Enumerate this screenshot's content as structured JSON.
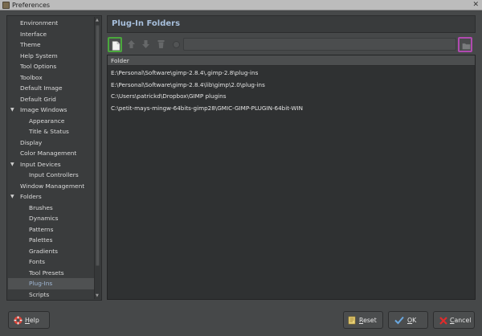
{
  "window": {
    "title": "Preferences",
    "close_glyph": "✕"
  },
  "sidebar": {
    "items": [
      {
        "label": "Environment",
        "level": 0
      },
      {
        "label": "Interface",
        "level": 0
      },
      {
        "label": "Theme",
        "level": 0
      },
      {
        "label": "Help System",
        "level": 0
      },
      {
        "label": "Tool Options",
        "level": 0
      },
      {
        "label": "Toolbox",
        "level": 0
      },
      {
        "label": "Default Image",
        "level": 0
      },
      {
        "label": "Default Grid",
        "level": 0
      },
      {
        "label": "Image Windows",
        "level": 0,
        "expanded": true
      },
      {
        "label": "Appearance",
        "level": 1
      },
      {
        "label": "Title & Status",
        "level": 1
      },
      {
        "label": "Display",
        "level": 0
      },
      {
        "label": "Color Management",
        "level": 0
      },
      {
        "label": "Input Devices",
        "level": 0,
        "expanded": true
      },
      {
        "label": "Input Controllers",
        "level": 1
      },
      {
        "label": "Window Management",
        "level": 0
      },
      {
        "label": "Folders",
        "level": 0,
        "expanded": true
      },
      {
        "label": "Brushes",
        "level": 1
      },
      {
        "label": "Dynamics",
        "level": 1
      },
      {
        "label": "Patterns",
        "level": 1
      },
      {
        "label": "Palettes",
        "level": 1
      },
      {
        "label": "Gradients",
        "level": 1
      },
      {
        "label": "Fonts",
        "level": 1
      },
      {
        "label": "Tool Presets",
        "level": 1
      },
      {
        "label": "Plug-Ins",
        "level": 1,
        "selected": true
      },
      {
        "label": "Scripts",
        "level": 1
      }
    ]
  },
  "main": {
    "title": "Plug-In Folders",
    "toolbar": {
      "icons": [
        "new-folder-icon",
        "move-up-icon",
        "move-down-icon",
        "delete-icon",
        "status-icon",
        "browse-folder-icon"
      ],
      "path_value": "",
      "highlight_new": "#4aa83c",
      "highlight_browse": "#b04ab0"
    },
    "table": {
      "column_header": "Folder",
      "rows": [
        "E:\\Personal\\Software\\gimp-2.8.4\\.gimp-2.8\\plug-ins",
        "E:\\Personal\\Software\\gimp-2.8.4\\lib\\gimp\\2.0\\plug-ins",
        "C:\\Users\\patrickd\\Dropbox\\GIMP plugins",
        "C:\\petit-mays-mingw-64bits-gimp28\\GMIC-GIMP-PLUGIN-64bit-WIN"
      ]
    }
  },
  "buttons": {
    "help": {
      "mnemonic": "H",
      "rest": "elp"
    },
    "reset": {
      "mnemonic": "R",
      "rest": "eset"
    },
    "ok": {
      "mnemonic": "O",
      "rest": "K"
    },
    "cancel": {
      "mnemonic": "C",
      "rest": "ancel"
    }
  },
  "colors": {
    "accent_title": "#a7bfdc",
    "selected_text": "#9fb6d4",
    "help_icon": "#e0463a",
    "ok_icon": "#6aa8e0",
    "cancel_icon": "#e02b2b"
  }
}
